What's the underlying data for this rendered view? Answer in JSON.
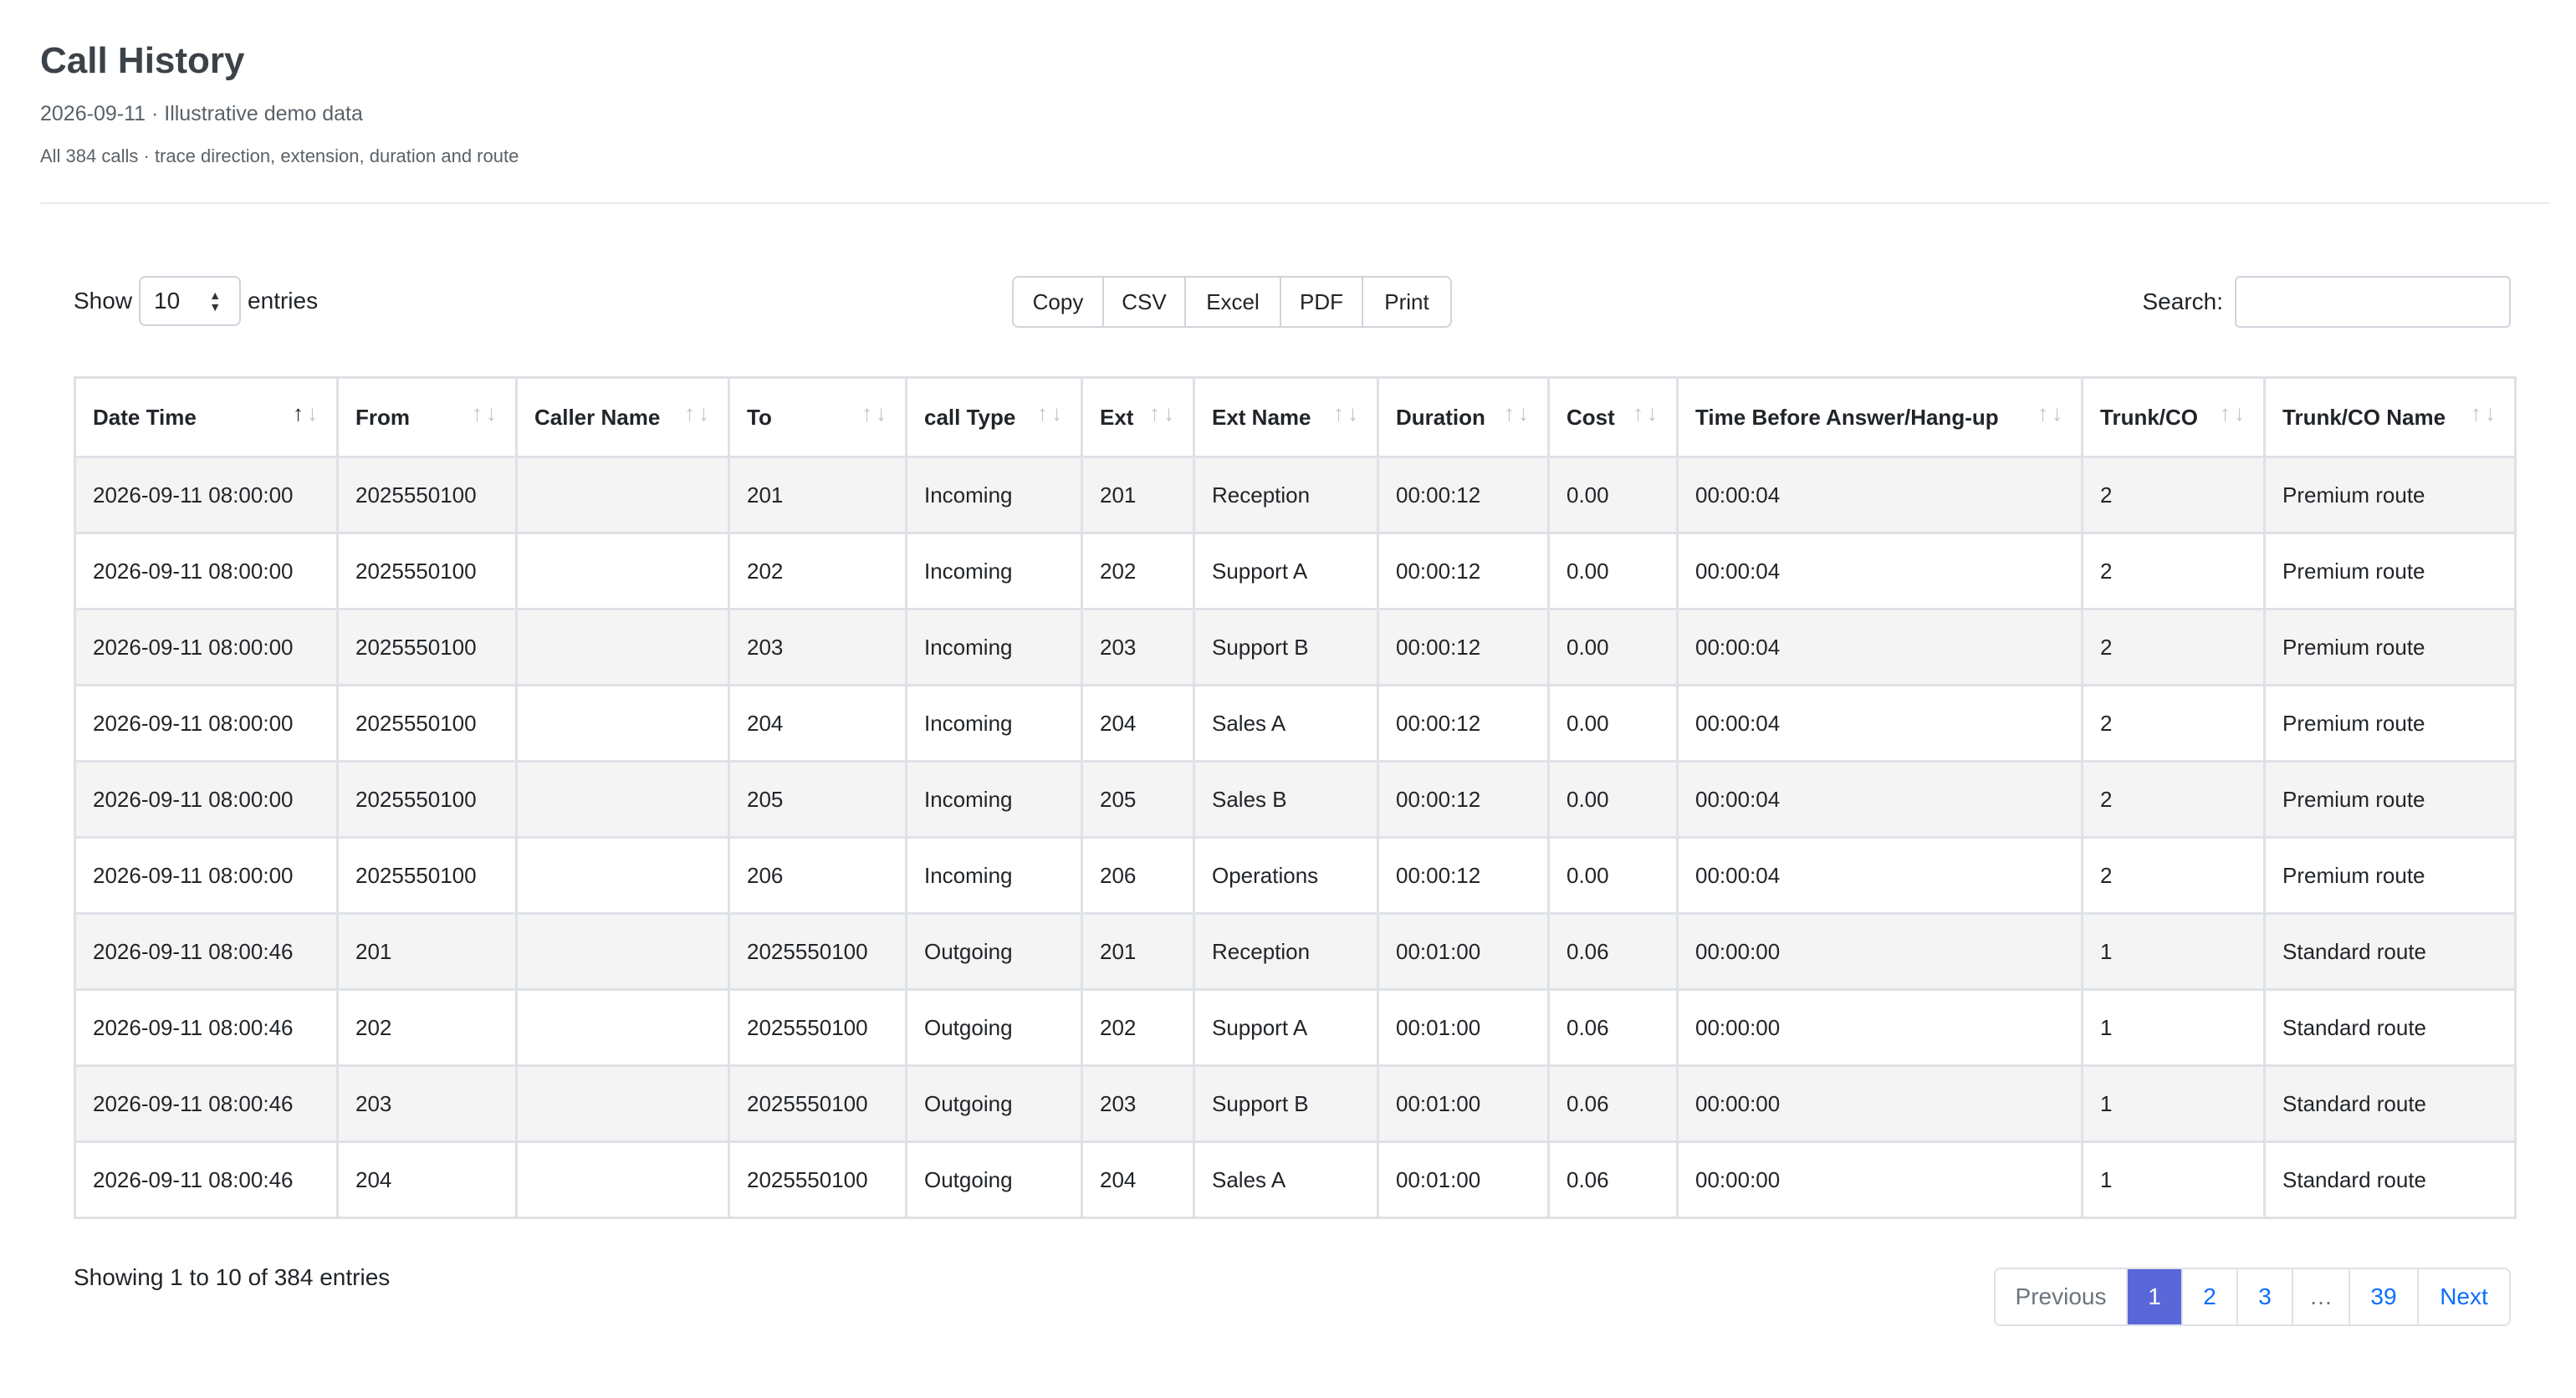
{
  "header": {
    "title": "Call History",
    "subtitle": "2026-09-11 · Illustrative demo data",
    "subtitle2": "All 384 calls · trace direction, extension, duration and route"
  },
  "length": {
    "show_label": "Show",
    "value": "10",
    "entries_label": "entries"
  },
  "export_buttons": [
    "Copy",
    "CSV",
    "Excel",
    "PDF",
    "Print"
  ],
  "search": {
    "label": "Search:",
    "placeholder": ""
  },
  "table": {
    "columns": [
      "Date Time",
      "From",
      "Caller Name",
      "To",
      "call Type",
      "Ext",
      "Ext Name",
      "Duration",
      "Cost",
      "Time Before Answer/Hang-up",
      "Trunk/CO",
      "Trunk/CO Name"
    ],
    "rows": [
      [
        "2026-09-11 08:00:00",
        "2025550100",
        "",
        "201",
        "Incoming",
        "201",
        "Reception",
        "00:00:12",
        "0.00",
        "00:00:04",
        "2",
        "Premium route"
      ],
      [
        "2026-09-11 08:00:00",
        "2025550100",
        "",
        "202",
        "Incoming",
        "202",
        "Support A",
        "00:00:12",
        "0.00",
        "00:00:04",
        "2",
        "Premium route"
      ],
      [
        "2026-09-11 08:00:00",
        "2025550100",
        "",
        "203",
        "Incoming",
        "203",
        "Support B",
        "00:00:12",
        "0.00",
        "00:00:04",
        "2",
        "Premium route"
      ],
      [
        "2026-09-11 08:00:00",
        "2025550100",
        "",
        "204",
        "Incoming",
        "204",
        "Sales A",
        "00:00:12",
        "0.00",
        "00:00:04",
        "2",
        "Premium route"
      ],
      [
        "2026-09-11 08:00:00",
        "2025550100",
        "",
        "205",
        "Incoming",
        "205",
        "Sales B",
        "00:00:12",
        "0.00",
        "00:00:04",
        "2",
        "Premium route"
      ],
      [
        "2026-09-11 08:00:00",
        "2025550100",
        "",
        "206",
        "Incoming",
        "206",
        "Operations",
        "00:00:12",
        "0.00",
        "00:00:04",
        "2",
        "Premium route"
      ],
      [
        "2026-09-11 08:00:46",
        "201",
        "",
        "2025550100",
        "Outgoing",
        "201",
        "Reception",
        "00:01:00",
        "0.06",
        "00:00:00",
        "1",
        "Standard route"
      ],
      [
        "2026-09-11 08:00:46",
        "202",
        "",
        "2025550100",
        "Outgoing",
        "202",
        "Support A",
        "00:01:00",
        "0.06",
        "00:00:00",
        "1",
        "Standard route"
      ],
      [
        "2026-09-11 08:00:46",
        "203",
        "",
        "2025550100",
        "Outgoing",
        "203",
        "Support B",
        "00:01:00",
        "0.06",
        "00:00:00",
        "1",
        "Standard route"
      ],
      [
        "2026-09-11 08:00:46",
        "204",
        "",
        "2025550100",
        "Outgoing",
        "204",
        "Sales A",
        "00:01:00",
        "0.06",
        "00:00:00",
        "1",
        "Standard route"
      ]
    ]
  },
  "info": "Showing 1 to 10 of 384 entries",
  "pagination": {
    "previous": "Previous",
    "pages": [
      "1",
      "2",
      "3",
      "…",
      "39"
    ],
    "next": "Next",
    "active": "1"
  },
  "colors": {
    "accent": "#5a67d8",
    "link": "#0d6efd",
    "stripe": "#f4f4f4",
    "border": "#dee2e6"
  }
}
